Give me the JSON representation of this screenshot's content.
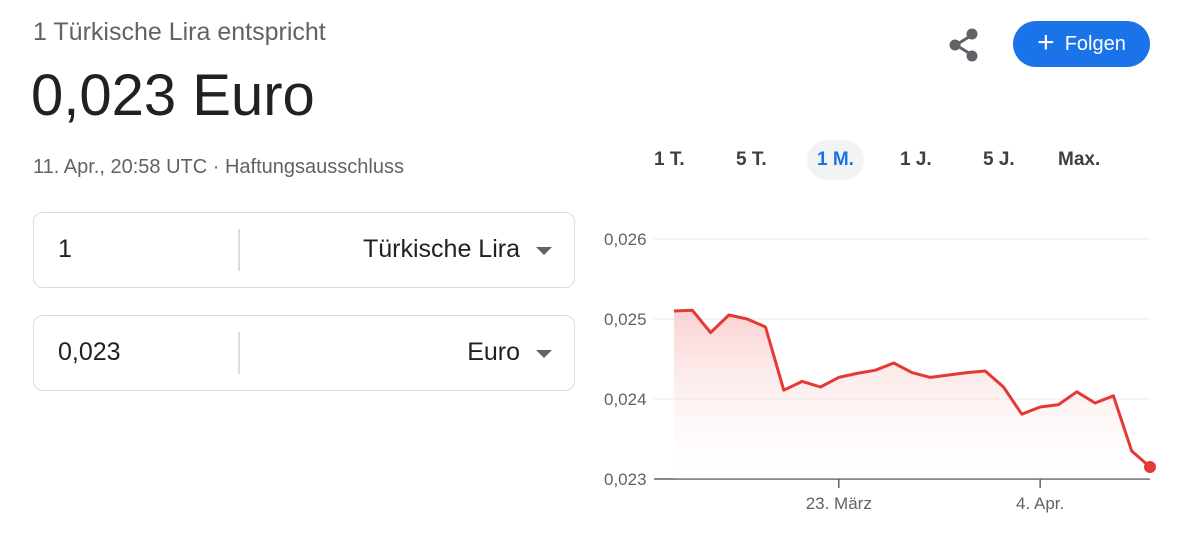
{
  "header": {
    "subtitle": "1 Türkische Lira entspricht",
    "rate_display": "0,023 Euro",
    "timestamp": "11. Apr., 20:58 UTC",
    "separator": " · ",
    "disclaimer": "Haftungsausschluss"
  },
  "actions": {
    "share_icon": "share-icon",
    "follow_label": "Folgen",
    "follow_icon": "+"
  },
  "converter": {
    "from": {
      "amount": "1",
      "currency": "Türkische Lira"
    },
    "to": {
      "amount": "0,023",
      "currency": "Euro"
    }
  },
  "ranges": {
    "tabs": [
      "1 T.",
      "5 T.",
      "1 M.",
      "1 J.",
      "5 J.",
      "Max."
    ],
    "active": "1 M."
  },
  "colors": {
    "accent": "#1a73e8",
    "line": "#e53935",
    "fill": "#fde7e7"
  },
  "chart_data": {
    "type": "area",
    "ylim": [
      0.023,
      0.026
    ],
    "yticks": [
      0.023,
      0.024,
      0.025,
      0.026
    ],
    "ytick_labels": [
      "0,023",
      "0,024",
      "0,025",
      "0,026"
    ],
    "xtick_labels": [
      {
        "label": "23. März",
        "index": 9
      },
      {
        "label": "4. Apr.",
        "index": 20
      }
    ],
    "values": [
      0.0251,
      0.02511,
      0.02483,
      0.02505,
      0.025,
      0.0249,
      0.02411,
      0.02422,
      0.02415,
      0.02427,
      0.02432,
      0.02436,
      0.02445,
      0.02433,
      0.02427,
      0.0243,
      0.02433,
      0.02435,
      0.02415,
      0.02381,
      0.0239,
      0.02393,
      0.02409,
      0.02395,
      0.02404,
      0.02335,
      0.02315
    ]
  }
}
